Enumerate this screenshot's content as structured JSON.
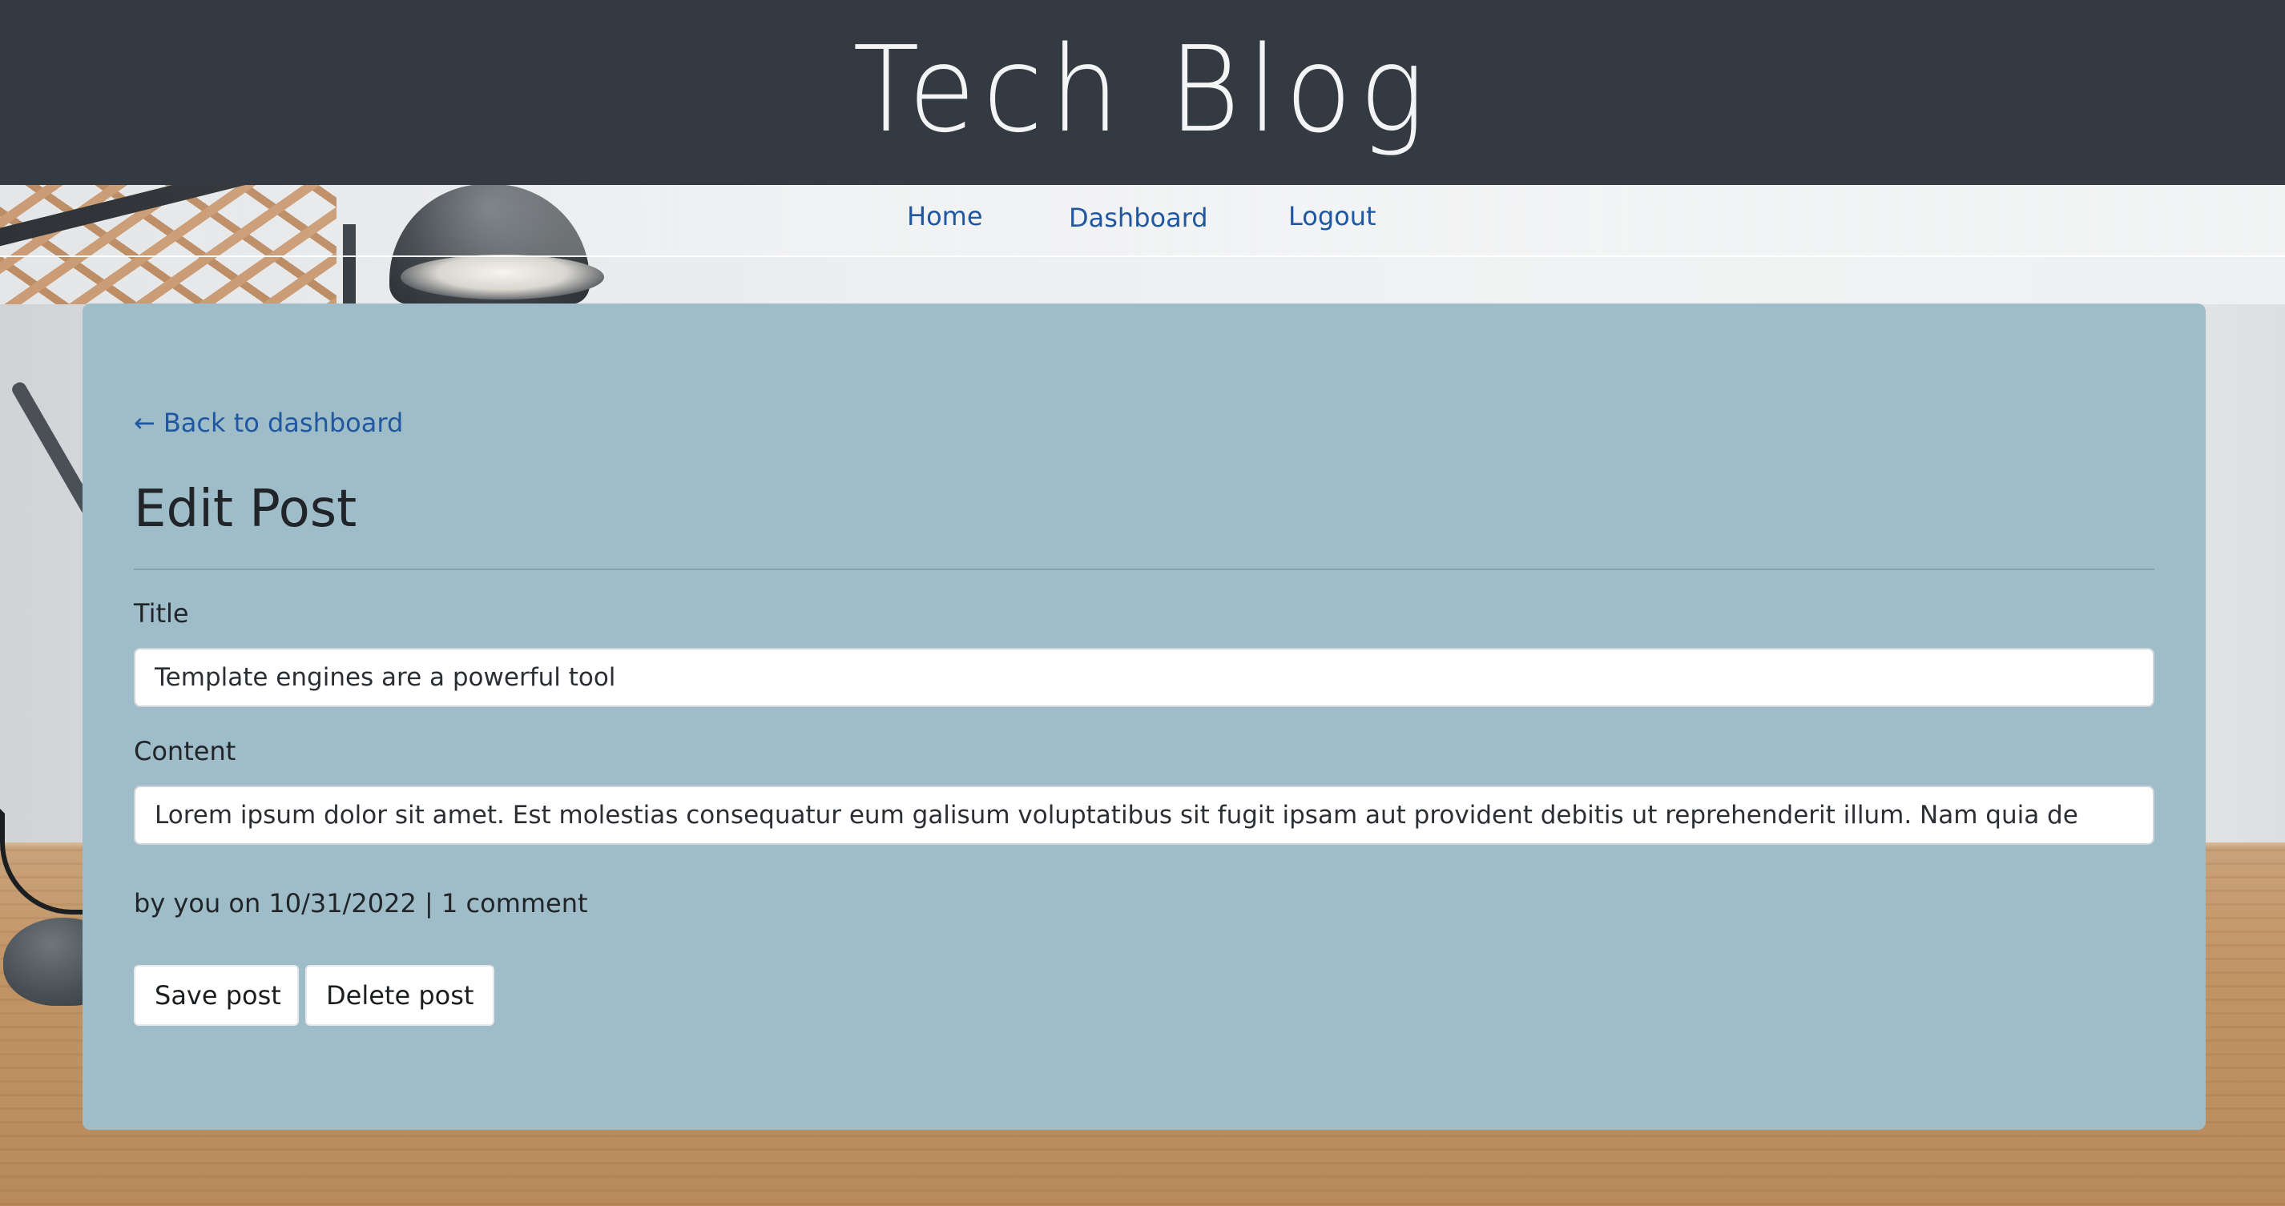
{
  "header": {
    "site_title": "Tech Blog"
  },
  "nav": {
    "items": [
      {
        "label": "Home"
      },
      {
        "label": "Dashboard"
      },
      {
        "label": "Logout"
      }
    ]
  },
  "main": {
    "back_link": {
      "arrow": "←",
      "label": "Back to dashboard"
    },
    "page_title": "Edit Post",
    "form": {
      "title_label": "Title",
      "title_value": "Template engines are a powerful tool",
      "content_label": "Content",
      "content_value": "Lorem ipsum dolor sit amet. Est molestias consequatur eum galisum voluptatibus sit fugit ipsam aut provident debitis ut reprehenderit illum. Nam quia de"
    },
    "meta": "by you on 10/31/2022 | 1 comment",
    "actions": {
      "save_label": "Save post",
      "delete_label": "Delete post"
    }
  },
  "colors": {
    "header_bg": "#343a42",
    "card_bg": "#9fbdc8",
    "link": "#1f57a0"
  }
}
